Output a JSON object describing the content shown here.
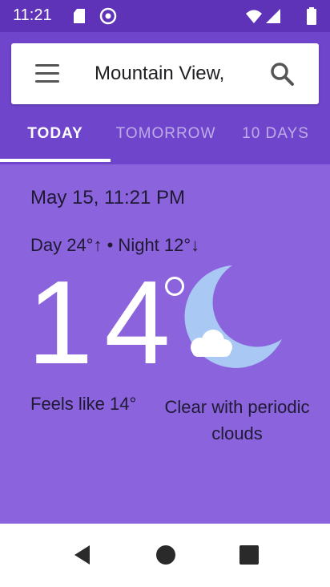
{
  "status_bar": {
    "time": "11:21",
    "icons": [
      "sd-card-icon",
      "at-icon",
      "wifi-icon",
      "signal-icon",
      "battery-icon"
    ]
  },
  "search": {
    "location": "Mountain View,",
    "menu_icon": "hamburger-menu-icon",
    "search_icon": "search-icon"
  },
  "tabs": [
    {
      "label": "TODAY",
      "active": true
    },
    {
      "label": "TOMORROW",
      "active": false
    },
    {
      "label": "10 DAYS",
      "active": false
    }
  ],
  "current": {
    "date": "May 15, 11:21 PM",
    "day_night": "Day 24°↑ • Night 12°↓",
    "temperature": "14",
    "feels_like": "Feels like 14°",
    "condition_line1": "Clear with periodic",
    "condition_line2": "clouds",
    "icon": "moon-cloud-icon"
  },
  "colors": {
    "status_bar": "#5e33b8",
    "header": "#6f45cc",
    "main": "#8b63dd",
    "moon": "#a9c8f3"
  },
  "nav": [
    "back-icon",
    "home-icon",
    "recents-icon"
  ]
}
